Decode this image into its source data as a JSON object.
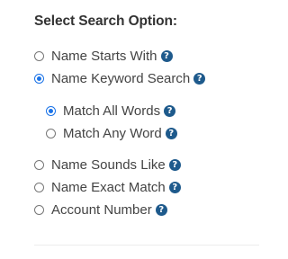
{
  "heading": "Select Search Option:",
  "help_glyph": "?",
  "colors": {
    "accent": "#1a73e8",
    "help_icon_bg": "#1e5a8c",
    "text": "#444444"
  },
  "options": [
    {
      "label": "Name Starts With",
      "selected": false
    },
    {
      "label": "Name Keyword Search",
      "selected": true
    },
    {
      "label": "Name Sounds Like",
      "selected": false
    },
    {
      "label": "Name Exact Match",
      "selected": false
    },
    {
      "label": "Account Number",
      "selected": false
    }
  ],
  "keyword_suboptions": [
    {
      "label": "Match All Words",
      "selected": true
    },
    {
      "label": "Match Any Word",
      "selected": false
    }
  ]
}
